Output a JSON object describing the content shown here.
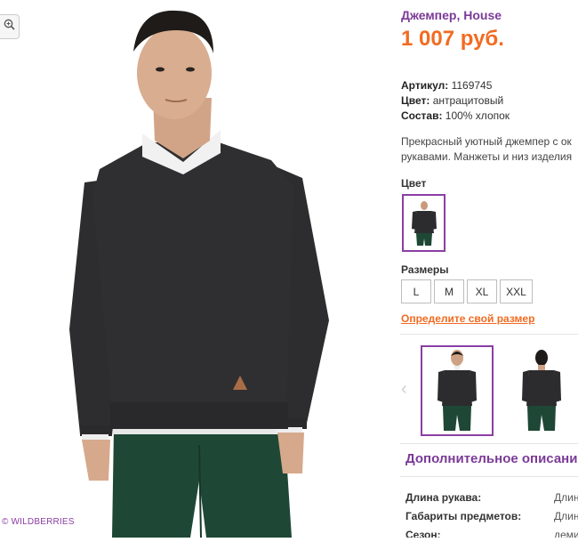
{
  "product": {
    "title": "Джемпер, House",
    "price": "1 007 руб.",
    "article_label": "Артикул:",
    "article_value": "1169745",
    "color_label": "Цвет:",
    "color_value": "антрацитовый",
    "composition_label": "Состав:",
    "composition_value": "100% хлопок",
    "description_line1": "Прекрасный уютный джемпер с ок",
    "description_line2": "рукавами. Манжеты и низ изделия"
  },
  "color_section": {
    "label": "Цвет"
  },
  "sizes_section": {
    "label": "Размеры",
    "sizes": [
      "L",
      "M",
      "XL",
      "XXL"
    ],
    "size_link": "Определите свой размер"
  },
  "watermark": "© WILDBERRIES",
  "additional": {
    "title": "Дополнительное описание",
    "rows": [
      {
        "key": "Длина рукава:",
        "value": "Длин"
      },
      {
        "key": "Габариты предметов:",
        "value": "Длин"
      },
      {
        "key": "Сезон:",
        "value": "деми"
      }
    ]
  },
  "icons": {
    "zoom": "zoom-in-icon",
    "thumb_prev": "chevron-left-icon"
  },
  "colors": {
    "brand_purple": "#7b3a97",
    "price_orange": "#f26b21",
    "sweater": "#2c2c2e",
    "pants": "#1f4736"
  }
}
